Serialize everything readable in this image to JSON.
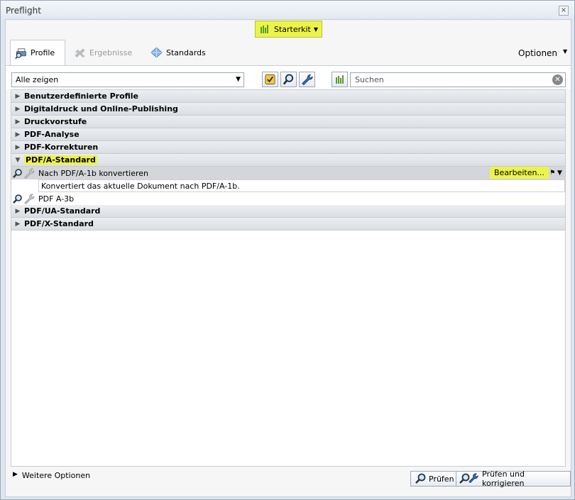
{
  "window": {
    "title": "Preflight",
    "close_glyph": "×"
  },
  "starterkit": {
    "label": "Starterkit",
    "icon": "bars-icon",
    "accent": "#ecf44a"
  },
  "tabs": [
    {
      "label": "Profile",
      "icon": "printer-magnifier-icon",
      "state": "active"
    },
    {
      "label": "Ergebnisse",
      "icon": "results-icon",
      "state": "disabled"
    },
    {
      "label": "Standards",
      "icon": "diamond-icon",
      "state": "normal"
    }
  ],
  "optionen": {
    "label": "Optionen"
  },
  "toolbar": {
    "filter_value": "Alle zeigen",
    "search_placeholder": "Suchen"
  },
  "categories": [
    {
      "label": "Benutzerdefinierte Profile",
      "expanded": false
    },
    {
      "label": "Digitaldruck und Online-Publishing",
      "expanded": false
    },
    {
      "label": "Druckvorstufe",
      "expanded": false
    },
    {
      "label": "PDF-Analyse",
      "expanded": false
    },
    {
      "label": "PDF-Korrekturen",
      "expanded": false
    },
    {
      "label": "PDF/A-Standard",
      "expanded": true
    },
    {
      "label": "PDF/UA-Standard",
      "expanded": false
    },
    {
      "label": "PDF/X-Standard",
      "expanded": false
    }
  ],
  "profiles": [
    {
      "label": "Nach PDF/A-1b konvertieren",
      "selected": true,
      "edit_label": "Bearbeiten...",
      "description": "Konvertiert das aktuelle Dokument nach PDF/A-1b."
    },
    {
      "label": "PDF A-3b",
      "selected": false
    }
  ],
  "footer": {
    "more_options": "Weitere Optionen",
    "check": "Prüfen",
    "check_fix": "Prüfen und korrigieren"
  }
}
